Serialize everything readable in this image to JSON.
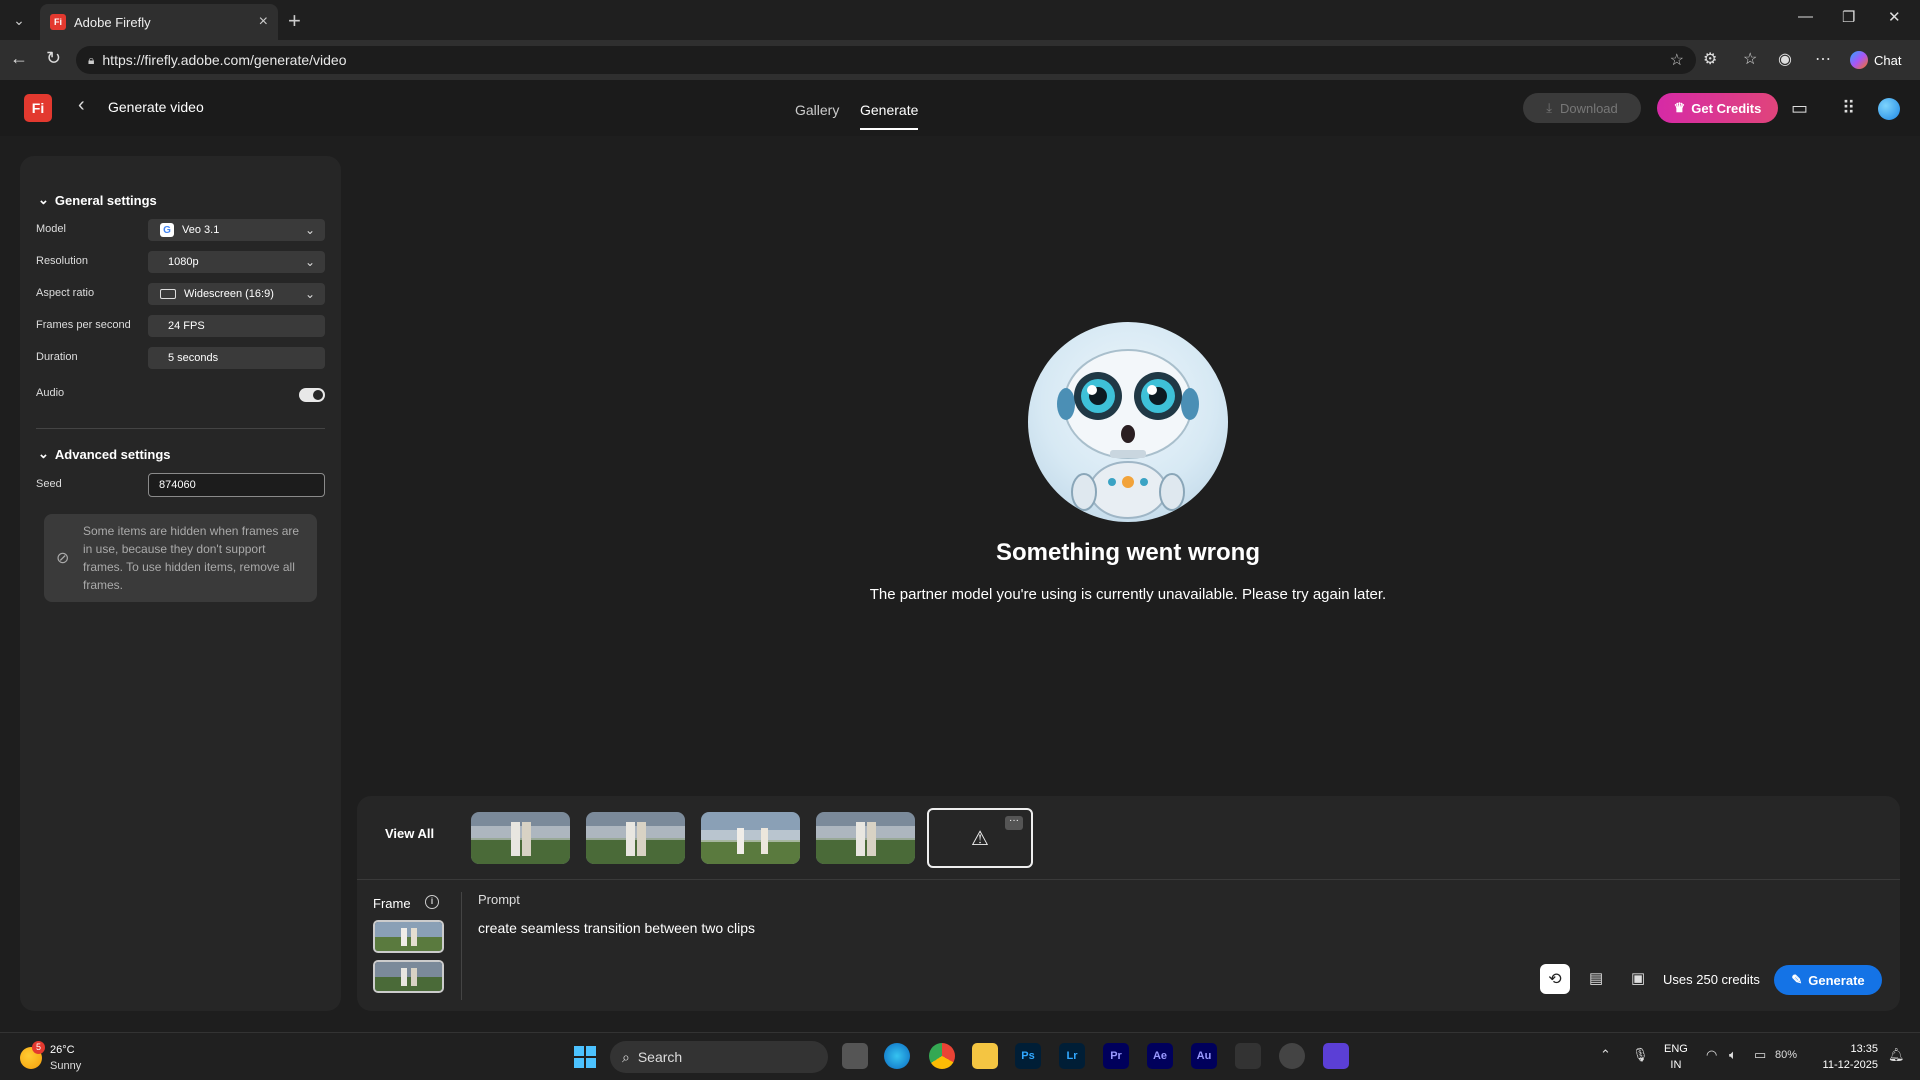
{
  "browser": {
    "tab_title": "Adobe Firefly",
    "favicon_text": "Fi",
    "url": "https://firefly.adobe.com/generate/video",
    "chat_label": "Chat"
  },
  "header": {
    "logo_text": "Fi",
    "page_title": "Generate video",
    "tabs": [
      {
        "label": "Gallery",
        "active": false
      },
      {
        "label": "Generate",
        "active": true
      }
    ],
    "download_label": "Download",
    "get_credits_label": "Get Credits"
  },
  "sidebar": {
    "general_settings_label": "General settings",
    "rows": {
      "model": {
        "label": "Model",
        "value": "Veo 3.1"
      },
      "resolution": {
        "label": "Resolution",
        "value": "1080p"
      },
      "aspect_ratio": {
        "label": "Aspect ratio",
        "value": "Widescreen (16:9)"
      },
      "fps": {
        "label": "Frames per second",
        "value": "24 FPS"
      },
      "duration": {
        "label": "Duration",
        "value": "5 seconds"
      },
      "audio": {
        "label": "Audio",
        "enabled": true
      }
    },
    "advanced_settings_label": "Advanced settings",
    "seed": {
      "label": "Seed",
      "value": "874060"
    },
    "notice": "Some items are hidden when frames are in use, because they don't support frames. To use hidden items, remove all frames."
  },
  "error": {
    "title": "Something went wrong",
    "message": "The partner model you're using is currently unavailable. Please try again later."
  },
  "bottom": {
    "view_all_label": "View All",
    "frame_label": "Frame",
    "prompt_label": "Prompt",
    "prompt_text": "create seamless transition between two clips",
    "credits_text": "Uses 250 credits",
    "generate_label": "Generate"
  },
  "taskbar": {
    "weather_badge": "5",
    "temperature": "26°C",
    "condition": "Sunny",
    "search_placeholder": "Search",
    "apps": [
      "Ps",
      "Lr",
      "Pr",
      "Ae",
      "Au"
    ],
    "lang_line1": "ENG",
    "lang_line2": "IN",
    "battery": "80%",
    "time": "13:35",
    "date": "11-12-2025"
  },
  "colors": {
    "accent_blue": "#1473e6",
    "credits_gradient_start": "#d62aa6",
    "firefly_red": "#e3392f"
  }
}
